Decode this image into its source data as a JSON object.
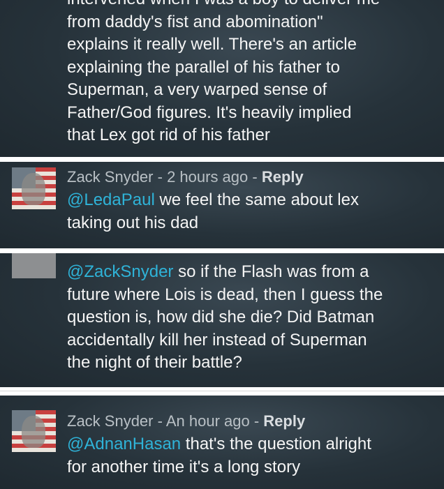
{
  "comments": [
    {
      "id": "c1",
      "lines": [
        "intervened when I was a boy to deliver me",
        "from daddy's fist and abomination\"",
        "explains it really well. There's an article",
        "explaining the parallel of his father to",
        "Superman, a very warped sense of",
        "Father/God figures. It's heavily implied",
        "that Lex got rid of his father"
      ]
    },
    {
      "id": "c2",
      "author": "Zack Snyder",
      "time": "2 hours ago",
      "reply_label": "Reply",
      "mention": "@LedaPaul",
      "text_first": " we feel the same about lex",
      "text_rest": "taking out his dad"
    },
    {
      "id": "c3",
      "mention": "@ZackSnyder",
      "text_first": " so if the Flash was from a",
      "lines": [
        "future where Lois is dead, then I guess the",
        "question is, how did she die? Did Batman",
        "accidentally kill her instead of Superman",
        "the night of their battle?"
      ]
    },
    {
      "id": "c4",
      "author": "Zack Snyder",
      "time": "An hour ago",
      "reply_label": "Reply",
      "mention": "@AdnanHasan",
      "text_first": " that's the question alright",
      "text_rest": "for another time it's a long story"
    }
  ],
  "meta_separator": " - ",
  "colors": {
    "card_bg": "#26323a",
    "mention": "#2fb3d8",
    "meta": "#b9c0c5",
    "text": "#f5f5f5"
  }
}
